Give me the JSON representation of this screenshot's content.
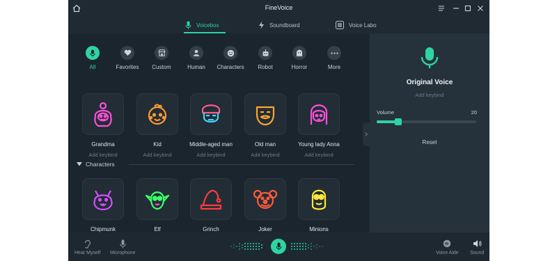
{
  "app": {
    "title": "FineVoice"
  },
  "tabs": [
    {
      "label": "Voicebox",
      "icon": "mic-icon",
      "active": true
    },
    {
      "label": "Soundboard",
      "icon": "lightning-icon",
      "active": false
    },
    {
      "label": "Voice Labo",
      "icon": "equalizer-icon",
      "active": false
    }
  ],
  "categories": [
    {
      "label": "All",
      "icon": "mic-icon",
      "active": true
    },
    {
      "label": "Favorites",
      "icon": "heart-icon"
    },
    {
      "label": "Custom",
      "icon": "shop-icon"
    },
    {
      "label": "Human",
      "icon": "person-icon"
    },
    {
      "label": "Characters",
      "icon": "smiley-icon"
    },
    {
      "label": "Robot",
      "icon": "robot-icon"
    },
    {
      "label": "Horror",
      "icon": "ghost-icon"
    },
    {
      "label": "More",
      "icon": "more-dots-icon"
    }
  ],
  "human_voices": [
    {
      "name": "Grandma",
      "keybind": "Add keybind",
      "icon": "grandma-icon",
      "color": "#ff4fd8"
    },
    {
      "name": "Kid",
      "keybind": "Add keybind",
      "icon": "kid-icon",
      "color": "#ff9a2e"
    },
    {
      "name": "Middle-aged man",
      "keybind": "Add keybind",
      "icon": "middle-aged-man-icon",
      "color": "#3fd4ff"
    },
    {
      "name": "Old man",
      "keybind": "Add keybind",
      "icon": "old-man-icon",
      "color": "#ffa62b"
    },
    {
      "name": "Young lady Anna",
      "keybind": "Add keybind",
      "icon": "young-lady-icon",
      "color": "#ff4fd8"
    }
  ],
  "section_characters": "Characters",
  "character_voices": [
    {
      "name": "Chipmunk",
      "icon": "chipmunk-icon",
      "color": "#d34fff"
    },
    {
      "name": "Elf",
      "icon": "elf-icon",
      "color": "#3dff6a"
    },
    {
      "name": "Grinch",
      "icon": "grinch-hat-icon",
      "color": "#ff3b3b"
    },
    {
      "name": "Joker",
      "icon": "joker-icon",
      "color": "#ff5a3b"
    },
    {
      "name": "Minions",
      "icon": "minion-icon",
      "color": "#ffe83b"
    }
  ],
  "right_panel": {
    "title": "Original Voice",
    "keybind": "Add keybind",
    "volume_label": "Volume",
    "volume_value": "20",
    "volume_fraction": 0.22,
    "reset_label": "Reset"
  },
  "bottom": {
    "hear_myself": "Hear Myself",
    "microphone": "Microphone",
    "voice_aide": "Voice Aide",
    "sound": "Sound"
  },
  "colors": {
    "accent": "#2fd3a4",
    "background": "#1b252d"
  }
}
